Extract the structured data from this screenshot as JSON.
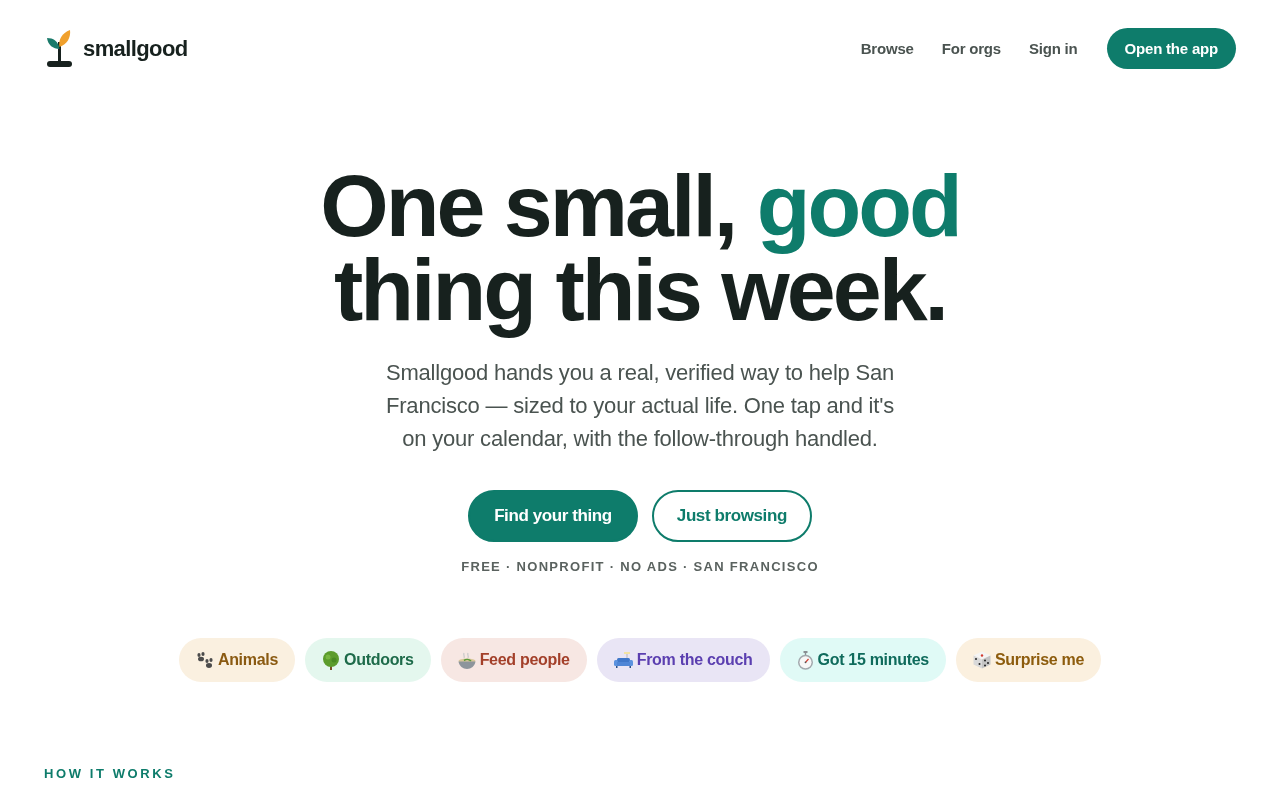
{
  "header": {
    "logo": {
      "wordmark": "smallgood"
    },
    "nav_links": [
      "Browse",
      "For orgs",
      "Sign in"
    ],
    "cta": "Open the app"
  },
  "hero": {
    "headline": [
      {
        "text": "One small, ",
        "accent": false
      },
      {
        "text": "good",
        "accent": true
      },
      {
        "text": " thing this week.",
        "accent": false
      }
    ],
    "subtitle": "Smallgood hands you a real, verified way to help San Francisco — sized to your actual life. One tap and it's on your calendar, with the follow-through handled.",
    "buttons": [
      {
        "label": "Find your thing",
        "kind": "primary"
      },
      {
        "label": "Just browsing",
        "kind": "secondary"
      }
    ],
    "tagline": "FREE · NONPROFIT · NO ADS · SAN FRANCISCO"
  },
  "categories": [
    {
      "label": "Animals",
      "color": "#8a5a12"
    },
    {
      "label": "Outdoors",
      "color": "#1e6b4a"
    },
    {
      "label": "Feed people",
      "color": "#a3402a"
    },
    {
      "label": "From the couch",
      "color": "#5b3fb0"
    },
    {
      "label": "Got 15 minutes",
      "color": "#0f6b5c"
    },
    {
      "label": "Surprise me",
      "color": "#8d5c0d"
    }
  ],
  "section_label": "HOW IT WORKS"
}
